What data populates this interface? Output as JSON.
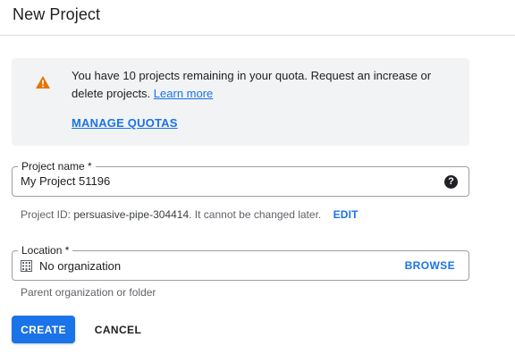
{
  "header": {
    "title": "New Project"
  },
  "quota_banner": {
    "message": "You have 10 projects remaining in your quota. Request an increase or delete projects.",
    "learn_more": "Learn more",
    "manage_quotas": "MANAGE QUOTAS",
    "warning_icon": "warning-triangle-icon",
    "warning_color": "#e37400"
  },
  "project_name": {
    "label": "Project name *",
    "value": "My Project 51196",
    "help_icon": "help-circle-icon"
  },
  "project_id": {
    "prefix": "Project ID: ",
    "id": "persuasive-pipe-304414",
    "suffix": ". It cannot be changed later.",
    "edit_label": "EDIT"
  },
  "location": {
    "label": "Location *",
    "value": "No organization",
    "browse_label": "BROWSE",
    "helper": "Parent organization or folder",
    "icon": "building-icon"
  },
  "actions": {
    "create_label": "CREATE",
    "cancel_label": "CANCEL"
  },
  "colors": {
    "accent": "#1a73e8",
    "banner_bg": "#f1f3f4",
    "border": "#9aa0a6"
  }
}
